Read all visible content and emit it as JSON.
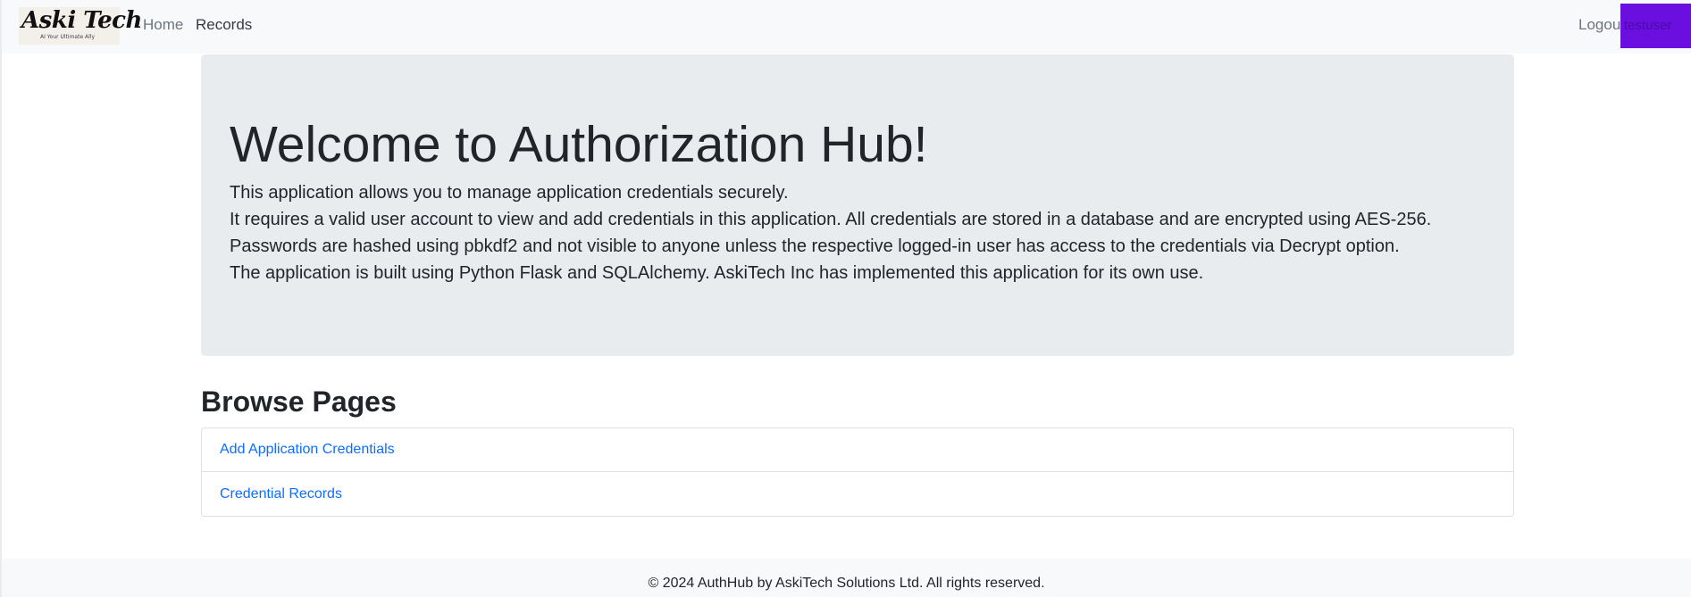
{
  "navbar": {
    "brand_name": "Aski Tech",
    "brand_tagline": "AI Your Ultimate Ally",
    "links": [
      {
        "label": "Home"
      },
      {
        "label": "Records"
      }
    ],
    "logout_label": "Logout",
    "user_label": "testuser",
    "user_box_color": "#6a0fe0"
  },
  "jumbotron": {
    "title": "Welcome to Authorization Hub!",
    "lines": [
      "This application allows you to manage application credentials securely.",
      "It requires a valid user account to view and add credentials in this application. All credentials are stored in a database and are encrypted using AES-256.",
      "Passwords are hashed using pbkdf2 and not visible to anyone unless the respective logged-in user has access to the credentials via Decrypt option.",
      "The application is built using Python Flask and SQLAlchemy. AskiTech Inc has implemented this application for its own use."
    ]
  },
  "browse": {
    "title": "Browse Pages",
    "items": [
      {
        "label": "Add Application Credentials"
      },
      {
        "label": "Credential Records"
      }
    ]
  },
  "footer": {
    "text": "© 2024 AuthHub by AskiTech Solutions Ltd. All rights reserved."
  }
}
